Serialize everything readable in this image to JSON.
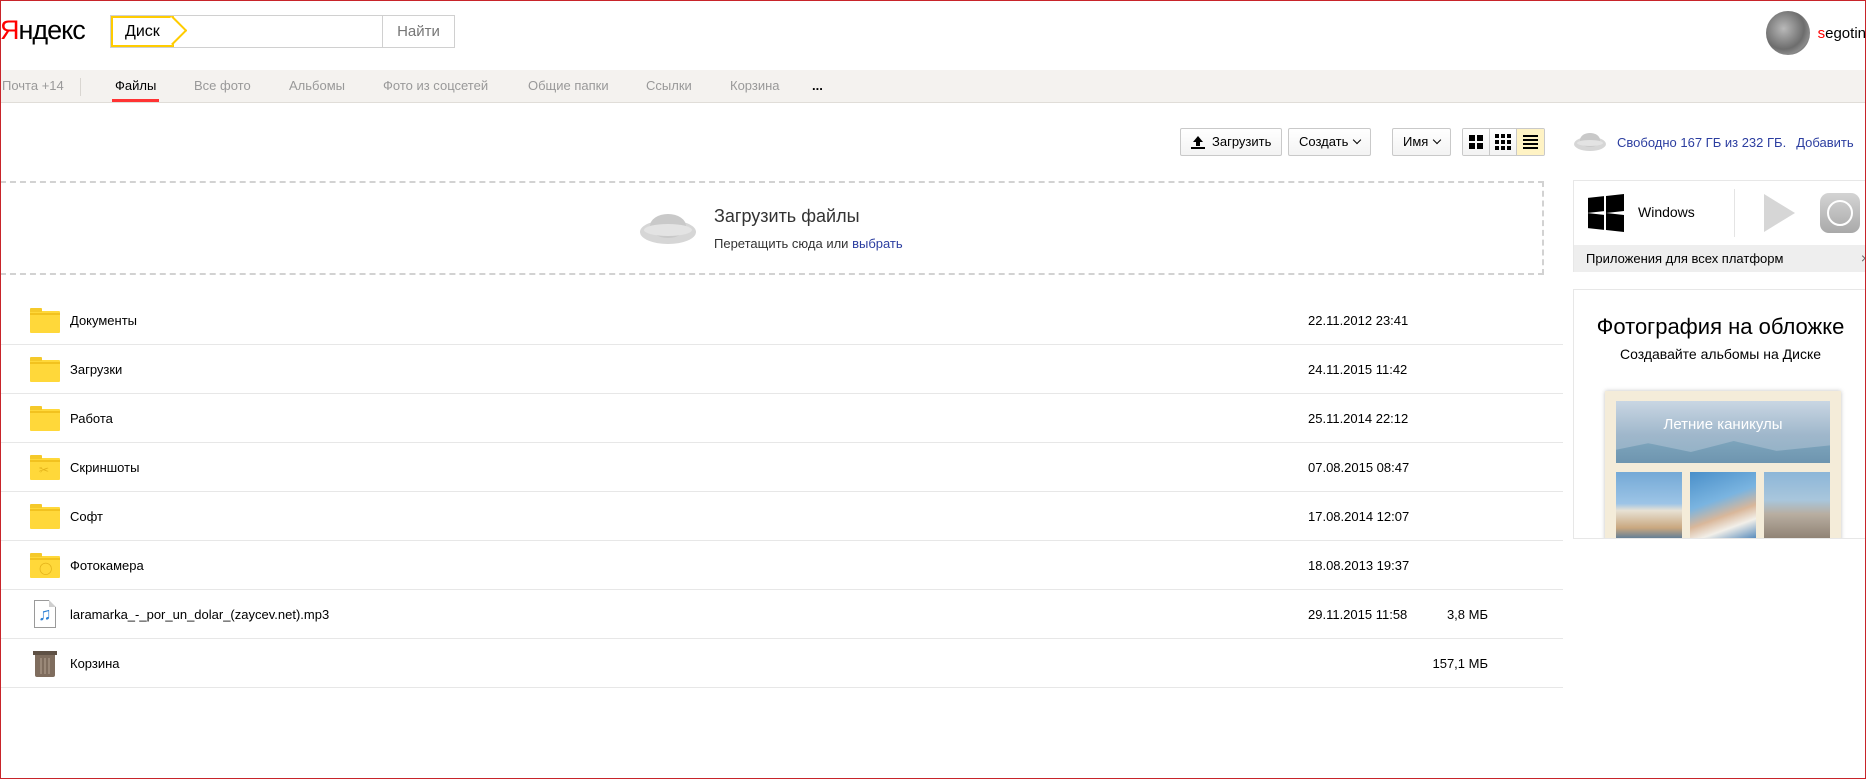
{
  "header": {
    "logo_first": "Я",
    "logo_rest": "ндекс",
    "search_tag": "Диск",
    "search_value": "",
    "search_button": "Найти",
    "user_first": "s",
    "user_rest": "egotin"
  },
  "tabs": [
    {
      "label": "Почта +14",
      "active": false
    },
    {
      "label": "Файлы",
      "active": true
    },
    {
      "label": "Все фото",
      "active": false
    },
    {
      "label": "Альбомы",
      "active": false
    },
    {
      "label": "Фото из соцсетей",
      "active": false
    },
    {
      "label": "Общие папки",
      "active": false
    },
    {
      "label": "Ссылки",
      "active": false
    },
    {
      "label": "Корзина",
      "active": false
    },
    {
      "label": "...",
      "active": false
    }
  ],
  "toolbar": {
    "upload": "Загрузить",
    "create": "Создать",
    "sort": "Имя",
    "view_active": "list-view"
  },
  "dropzone": {
    "title": "Загрузить файлы",
    "sub_prefix": "Перетащить сюда или ",
    "sub_link": "выбрать"
  },
  "files": [
    {
      "name": "Документы",
      "date": "22.11.2012 23:41",
      "size": "",
      "icon": "folder-icon"
    },
    {
      "name": "Загрузки",
      "date": "24.11.2015 11:42",
      "size": "",
      "icon": "folder-icon"
    },
    {
      "name": "Работа",
      "date": "25.11.2014 22:12",
      "size": "",
      "icon": "folder-icon"
    },
    {
      "name": "Скриншоты",
      "date": "07.08.2015 08:47",
      "size": "",
      "icon": "screenshots-folder-icon"
    },
    {
      "name": "Софт",
      "date": "17.08.2014 12:07",
      "size": "",
      "icon": "folder-icon"
    },
    {
      "name": "Фотокамера",
      "date": "18.08.2013 19:37",
      "size": "",
      "icon": "camera-folder-icon"
    },
    {
      "name": "laramarka_-_por_un_dolar_(zaycev.net).mp3",
      "date": "29.11.2015 11:58",
      "size": "3,8 МБ",
      "icon": "audio-file-icon"
    },
    {
      "name": "Корзина",
      "date": "",
      "size": "157,1 МБ",
      "icon": "trash-icon"
    }
  ],
  "sidebar": {
    "space_text": "Свободно 167 ГБ из 232 ГБ.",
    "space_add": "Добавить",
    "apps_windows": "Windows",
    "apps_all": "Приложения для всех платформ",
    "apps_close": "×",
    "promo_title": "Фотография на обложке",
    "promo_sub": "Создавайте альбомы на Диске",
    "album_label": "Летние каникулы"
  },
  "colors": {
    "accent_red": "#ff3333",
    "search_yellow": "#ffcc00",
    "link_blue": "#2c3ea0",
    "folder_yellow": "#ffd83a"
  }
}
